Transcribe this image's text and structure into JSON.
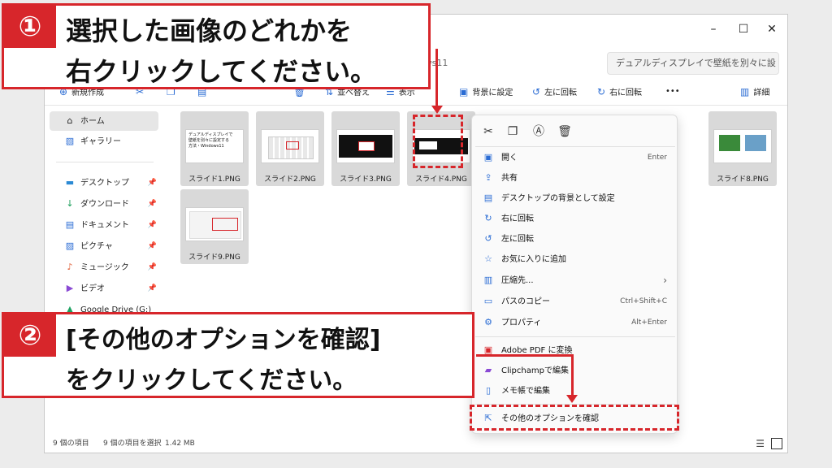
{
  "window": {
    "controls": [
      "–",
      "☐",
      "✕"
    ],
    "address_text": "デュアルディスプレイで壁紙を別々に設定する方法 › Windows11",
    "search_placeholder": "デュアルディスプレイで壁紙を別々に設"
  },
  "toolbar": {
    "new": "新規作成",
    "sort": "並べ替え",
    "view": "表示",
    "set_background": "背景に設定",
    "rotate_left": "左に回転",
    "rotate_right": "右に回転",
    "more": "•••",
    "details": "詳細"
  },
  "sidebar": {
    "home": "ホーム",
    "gallery": "ギャラリー",
    "desktop": "デスクトップ",
    "downloads": "ダウンロード",
    "documents": "ドキュメント",
    "pictures": "ピクチャ",
    "music": "ミュージック",
    "videos": "ビデオ",
    "gdrive": "Google Drive (G:)"
  },
  "files": [
    "スライド1.PNG",
    "スライド2.PNG",
    "スライド3.PNG",
    "スライド4.PNG",
    "スライド8.PNG",
    "スライド9.PNG"
  ],
  "thumb1_text": "デュアルディスプレイで\n壁紙を別々に設定する\n方法・Windows11",
  "status": {
    "count": "9 個の項目",
    "selected": "9 個の項目を選択",
    "size": "1.42 MB"
  },
  "context_menu": {
    "open": "開く",
    "open_sc": "Enter",
    "share": "共有",
    "set_desktop_bg": "デスクトップの背景として設定",
    "rotate_right": "右に回転",
    "rotate_left": "左に回転",
    "add_favorites": "お気に入りに追加",
    "compress": "圧縮先...",
    "copy_path": "パスのコピー",
    "copy_path_sc": "Ctrl+Shift+C",
    "properties": "プロパティ",
    "properties_sc": "Alt+Enter",
    "adobe_pdf": "Adobe PDF に変換",
    "clipchamp": "Clipchampで編集",
    "notepad": "メモ帳で編集",
    "more_options": "その他のオプションを確認"
  },
  "callouts": {
    "one_num": "①",
    "one_line1": "選択した画像のどれかを",
    "one_line2": "右クリックしてください。",
    "two_num": "②",
    "two_line1": "[その他のオプションを確認]",
    "two_line2": "をクリックしてください。"
  },
  "colors": {
    "accent_red": "#d7262b",
    "selection_gray": "#d9d9d9",
    "icon_blue": "#2b6cd4"
  }
}
